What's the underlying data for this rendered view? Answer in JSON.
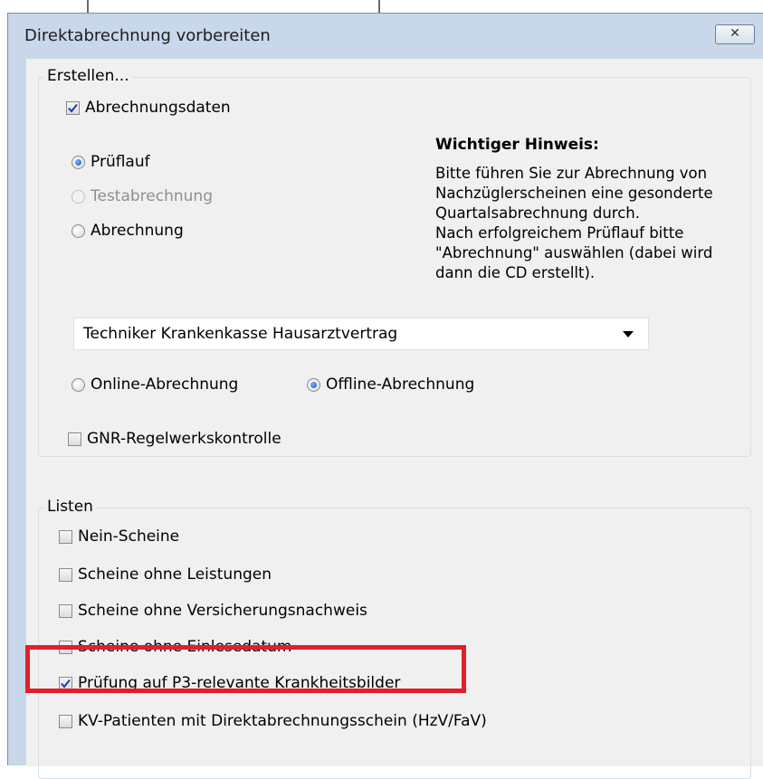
{
  "dialog": {
    "title": "Direktabrechnung vorbereiten",
    "close_glyph": "✕"
  },
  "erstellen": {
    "legend": "Erstellen...",
    "abrechnungsdaten": {
      "label": "Abrechnungsdaten",
      "checked": true
    },
    "radios": [
      {
        "label": "Prüflauf",
        "selected": true,
        "enabled": true
      },
      {
        "label": "Testabrechnung",
        "selected": false,
        "enabled": false
      },
      {
        "label": "Abrechnung",
        "selected": false,
        "enabled": true
      }
    ],
    "notice_title": "Wichtiger Hinweis:",
    "notice_body": "Bitte führen Sie zur Abrechnung von\nNachzüglerscheinen eine gesonderte\nQuartalsabrechnung durch.\nNach erfolgreichem Prüflauf bitte\n\"Abrechnung\" auswählen (dabei wird\ndann die CD erstellt).",
    "dropdown_value": "Techniker Krankenkasse Hausarztvertrag",
    "mode_radios": [
      {
        "label": "Online-Abrechnung",
        "selected": false
      },
      {
        "label": "Offline-Abrechnung",
        "selected": true
      }
    ],
    "gnr": {
      "label": "GNR-Regelwerkskontrolle",
      "checked": false
    }
  },
  "listen": {
    "legend": "Listen",
    "items": [
      {
        "label": "Nein-Scheine",
        "checked": false
      },
      {
        "label": "Scheine ohne Leistungen",
        "checked": false
      },
      {
        "label": "Scheine ohne Versicherungsnachweis",
        "checked": false
      },
      {
        "label": "Scheine ohne Einlesedatum",
        "checked": false
      },
      {
        "label": "Prüfung auf P3-relevante Krankheitsbilder",
        "checked": true
      },
      {
        "label": "KV-Patienten mit Direktabrechnungsschein (HzV/FaV)",
        "checked": false
      }
    ]
  },
  "colors": {
    "highlight": "#e0202a",
    "title_bar": "#c8d7e9",
    "client_bg": "#f0f0f0"
  }
}
